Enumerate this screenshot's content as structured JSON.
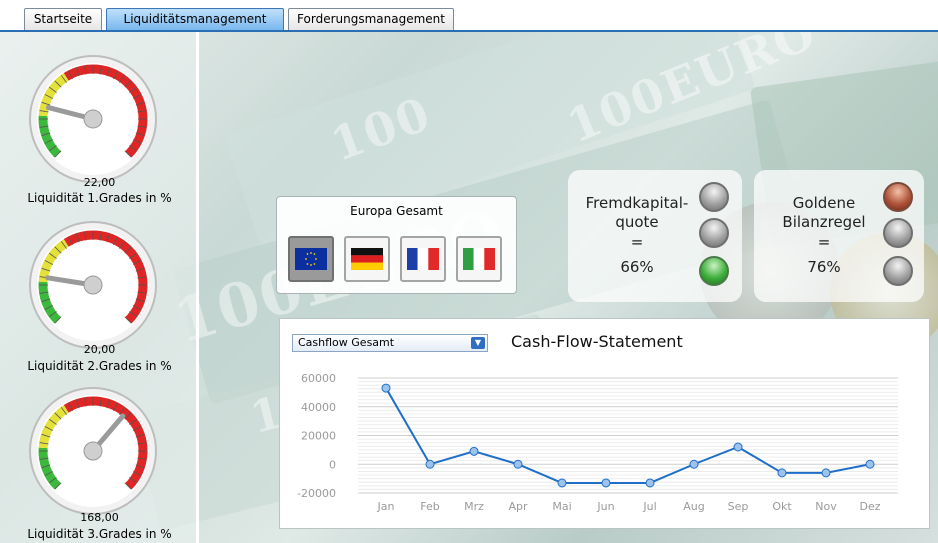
{
  "tabs": [
    {
      "label": "Startseite",
      "active": false
    },
    {
      "label": "Liquiditätsmanagement",
      "active": true
    },
    {
      "label": "Forderungsmanagement",
      "active": false
    }
  ],
  "gauges": [
    {
      "value": "22,00",
      "label": "Liquidität 1.Grades in %",
      "needle_level": 0.22
    },
    {
      "value": "20,00",
      "label": "Liquidität 2.Grades in %",
      "needle_level": 0.2
    },
    {
      "value": "168,00",
      "label": "Liquidität 3.Grades in %",
      "needle_level": 0.65
    }
  ],
  "europa": {
    "title": "Europa Gesamt",
    "flags": [
      {
        "name": "eu",
        "selected": true
      },
      {
        "name": "germany",
        "selected": false
      },
      {
        "name": "france",
        "selected": false
      },
      {
        "name": "italy",
        "selected": false
      }
    ]
  },
  "fremdkapital": {
    "label_line1": "Fremdkapital-",
    "label_line2": "quote",
    "equals": "=",
    "value": "66%",
    "lights": [
      "grey",
      "grey",
      "green"
    ]
  },
  "bilanzregel": {
    "label_line1": "Goldene",
    "label_line2": "Bilanzregel",
    "equals": "=",
    "value": "76%",
    "lights": [
      "red",
      "grey",
      "grey"
    ]
  },
  "cashflow": {
    "select_value": "Cashflow Gesamt",
    "title": "Cash-Flow-Statement"
  },
  "chart_data": {
    "type": "line",
    "title": "Cash-Flow-Statement",
    "x": [
      "Jan",
      "Feb",
      "Mrz",
      "Apr",
      "Mai",
      "Jun",
      "Jul",
      "Aug",
      "Sep",
      "Okt",
      "Nov",
      "Dez"
    ],
    "series": [
      {
        "values": [
          53000,
          0,
          9000,
          0,
          -13000,
          -13000,
          -13000,
          0,
          12000,
          -6000,
          -6000,
          0
        ]
      }
    ],
    "yticks": [
      60000,
      40000,
      20000,
      0,
      -20000
    ],
    "ylim": [
      -20000,
      60000
    ],
    "grid": true,
    "line_color": "#1f6fc9"
  }
}
